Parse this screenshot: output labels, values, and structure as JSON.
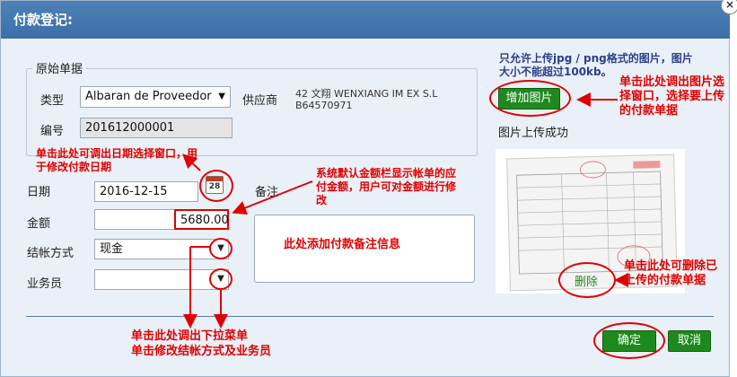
{
  "dialog": {
    "title": "付款登记:",
    "close_glyph": "×"
  },
  "section": {
    "legend": "原始单据",
    "type_label": "类型",
    "type_value": "Albaran de Proveedor",
    "supplier_label": "供应商",
    "supplier_line1": "42 文翔 WENXIANG IM EX S.L",
    "supplier_line2": "B64570971",
    "number_label": "编号",
    "number_value": "201612000001"
  },
  "form": {
    "date_label": "日期",
    "date_value": "2016-12-15",
    "calendar_day": "28",
    "amount_label": "金额",
    "amount_value": "5680.00",
    "settle_label": "结帐方式",
    "settle_value": "现金",
    "staff_label": "业务员",
    "staff_value": "",
    "remark_label": "备注",
    "remark_value": ""
  },
  "upload": {
    "hint": "只允许上传jpg / png格式的图片，图片大小不能超过100kb。",
    "add_button": "增加图片",
    "success_text": "图片上传成功",
    "delete_link": "删除"
  },
  "buttons": {
    "confirm": "确定",
    "cancel": "取消"
  },
  "annotations": {
    "date": "单击此处可调出日期选择窗口，用于修改付款日期",
    "amount": "系统默认金额栏显示帐单的应付金额，用户可对金额进行修改",
    "remark": "此处添加付款备注信息",
    "add_image": "单击此处调出图片选择窗口，选择要上传的付款单据",
    "delete_image": "单击此处可删除已上传的付款单据",
    "dropdown_line1": "单击此处调出下拉菜单",
    "dropdown_line2": "单击修改结帐方式及业务员"
  },
  "colors": {
    "title_bar": "#3c6ea8",
    "annotation_red": "#e00000",
    "button_green": "#1e8a1e"
  }
}
